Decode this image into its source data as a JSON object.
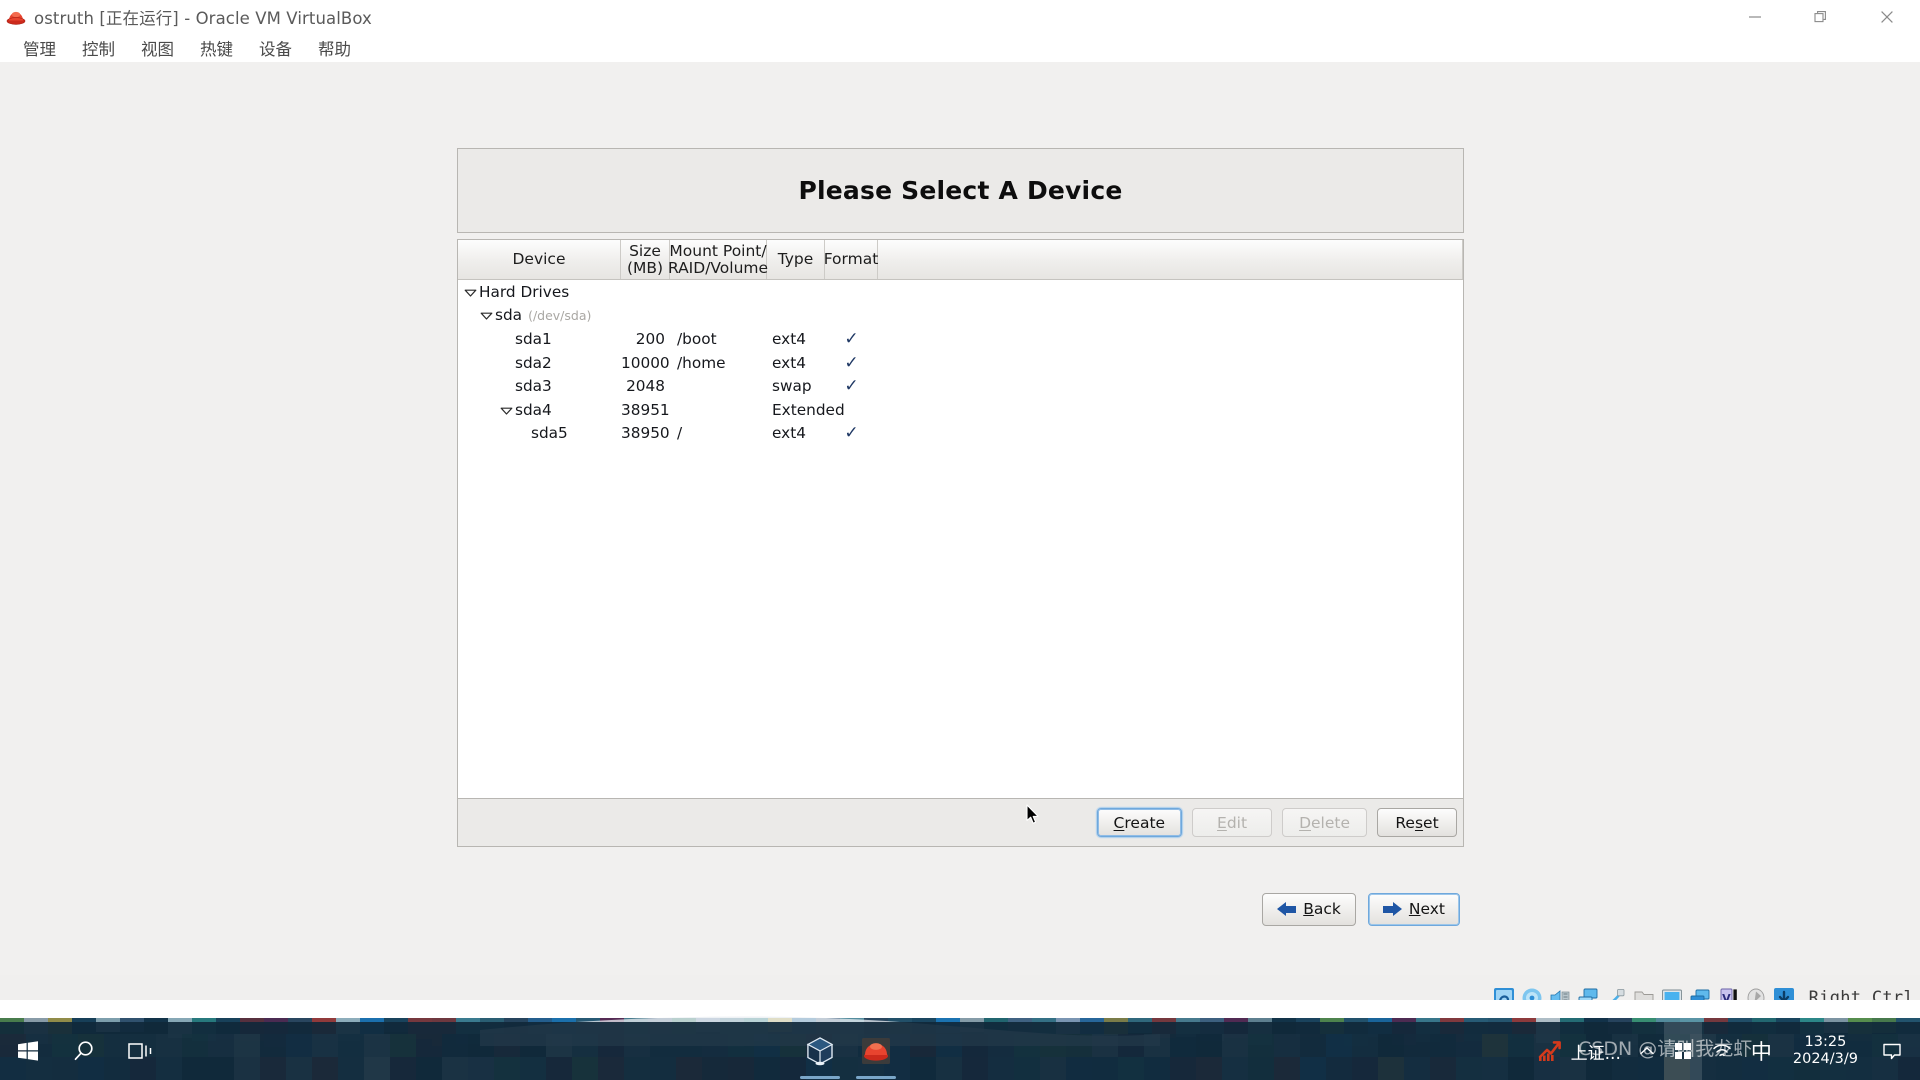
{
  "host_window": {
    "title": "ostruth [正在运行] - Oracle VM VirtualBox",
    "app_icon": "redhat-icon",
    "controls": [
      {
        "name": "minimize-button",
        "glyph": "—"
      },
      {
        "name": "restore-button",
        "glyph": "❐"
      },
      {
        "name": "close-button",
        "glyph": "✕"
      }
    ],
    "menu": [
      {
        "label": "管理"
      },
      {
        "label": "控制"
      },
      {
        "label": "视图"
      },
      {
        "label": "热键"
      },
      {
        "label": "设备"
      },
      {
        "label": "帮助"
      }
    ]
  },
  "dialog": {
    "title": "Please Select A Device",
    "table": {
      "columns": [
        {
          "key": "device",
          "label": "Device"
        },
        {
          "key": "size",
          "label": "Size\n(MB)",
          "line1": "Size",
          "line2": "(MB)"
        },
        {
          "key": "mount",
          "label": "Mount Point/\nRAID/Volume",
          "line1": "Mount Point/",
          "line2": "RAID/Volume"
        },
        {
          "key": "type",
          "label": "Type"
        },
        {
          "key": "format",
          "label": "Format"
        }
      ],
      "rows": [
        {
          "indent": 0,
          "twisty": "expanded",
          "device": "Hard Drives",
          "sub": "",
          "size": "",
          "mount": "",
          "type": "",
          "format": ""
        },
        {
          "indent": 1,
          "twisty": "expanded",
          "device": "sda",
          "sub": "(/dev/sda)",
          "size": "",
          "mount": "",
          "type": "",
          "format": ""
        },
        {
          "indent": 2,
          "twisty": "none",
          "device": "sda1",
          "sub": "",
          "size": "200",
          "mount": "/boot",
          "type": "ext4",
          "format": "✓"
        },
        {
          "indent": 2,
          "twisty": "none",
          "device": "sda2",
          "sub": "",
          "size": "10000",
          "mount": "/home",
          "type": "ext4",
          "format": "✓"
        },
        {
          "indent": 2,
          "twisty": "none",
          "device": "sda3",
          "sub": "",
          "size": "2048",
          "mount": "",
          "type": "swap",
          "format": "✓"
        },
        {
          "indent": 2,
          "twisty": "expanded",
          "device": "sda4",
          "sub": "",
          "size": "38951",
          "mount": "",
          "type": "Extended",
          "format": ""
        },
        {
          "indent": 3,
          "twisty": "none",
          "device": "sda5",
          "sub": "",
          "size": "38950",
          "mount": "/",
          "type": "ext4",
          "format": "✓"
        }
      ]
    },
    "actions": [
      {
        "name": "create-button",
        "label": "Create",
        "accel": "C",
        "pre": "",
        "post": "reate",
        "disabled": false,
        "focused": true
      },
      {
        "name": "edit-button",
        "label": "Edit",
        "accel": "E",
        "pre": "",
        "post": "dit",
        "disabled": true,
        "focused": false
      },
      {
        "name": "delete-button",
        "label": "Delete",
        "accel": "D",
        "pre": "",
        "post": "elete",
        "disabled": true,
        "focused": false
      },
      {
        "name": "reset-button",
        "label": "Reset",
        "accel": "s",
        "pre": "Re",
        "post": "et",
        "disabled": false,
        "focused": false
      }
    ],
    "nav": [
      {
        "name": "back-button",
        "label": "Back",
        "accel": "B",
        "pre": "",
        "post": "ack",
        "icon": "arrow-left-icon",
        "focused": false
      },
      {
        "name": "next-button",
        "label": "Next",
        "accel": "N",
        "pre": "",
        "post": "ext",
        "icon": "arrow-right-icon",
        "focused": true
      }
    ]
  },
  "vb_statusbar": {
    "icons": [
      "hard-disk-icon",
      "optical-disk-icon",
      "audio-icon",
      "network-icon",
      "usb-icon",
      "shared-folders-icon",
      "display-icon",
      "video-capture-icon",
      "vm-features-icon",
      "mouse-icon",
      "host-key-icon"
    ],
    "host_key_label": "Right Ctrl"
  },
  "taskbar": {
    "left_buttons": [
      {
        "name": "start-button",
        "icon": "windows-logo-icon"
      },
      {
        "name": "search-button",
        "icon": "search-icon"
      },
      {
        "name": "task-view-button",
        "icon": "task-view-icon"
      }
    ],
    "apps": [
      {
        "name": "taskbar-app-virtualbox",
        "icon": "virtualbox-cube-icon"
      },
      {
        "name": "taskbar-app-redhat",
        "icon": "redhat-icon"
      }
    ],
    "tray": {
      "stock_label": "上证...",
      "stock_icon": "stock-trend-icon",
      "chevron_icon": "chevron-up-icon",
      "items": [
        {
          "name": "tray-windows-defender",
          "icon": "flag-icon"
        },
        {
          "name": "tray-network",
          "icon": "wifi-icon"
        },
        {
          "name": "tray-ime",
          "icon": "ime-chinese-icon",
          "label": "中"
        }
      ]
    },
    "clock": {
      "time": "13:25",
      "date": "2024/3/9"
    },
    "notification_icon": "action-center-icon"
  },
  "watermark": "CSDN @请叫我龙虾",
  "colors": {
    "accent_blue": "#1f56a5",
    "check_navy": "#1f3864",
    "taskbar": "#10283a",
    "panel_bg": "#ebeae8"
  }
}
